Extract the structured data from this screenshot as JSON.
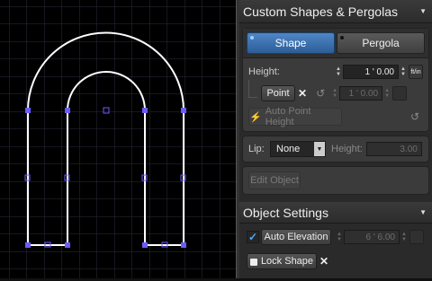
{
  "custom_shapes": {
    "title": "Custom Shapes & Pergolas",
    "tabs": [
      {
        "label": "Shape",
        "active": true
      },
      {
        "label": "Pergola",
        "active": false
      }
    ],
    "height_label": "Height:",
    "height_value": "1 ' 0.00",
    "unit_label": "ft/in",
    "point_button": "Point",
    "disabled_value": "1 ' 0.00",
    "auto_point_height": "Auto Point Height",
    "lip_label": "Lip:",
    "lip_value": "None",
    "lip_height_label": "Height:",
    "lip_height_value": "3.00",
    "edit_object": "Edit Object"
  },
  "object_settings": {
    "title": "Object Settings",
    "auto_elevation": "Auto Elevation",
    "auto_elevation_checked": true,
    "elevation_value": "6 ' 6.00",
    "lock_shape": "Lock Shape"
  },
  "colors": {
    "accent": "#4f86c6",
    "handle": "#7b6cff",
    "grid": "#2a2a3a"
  }
}
